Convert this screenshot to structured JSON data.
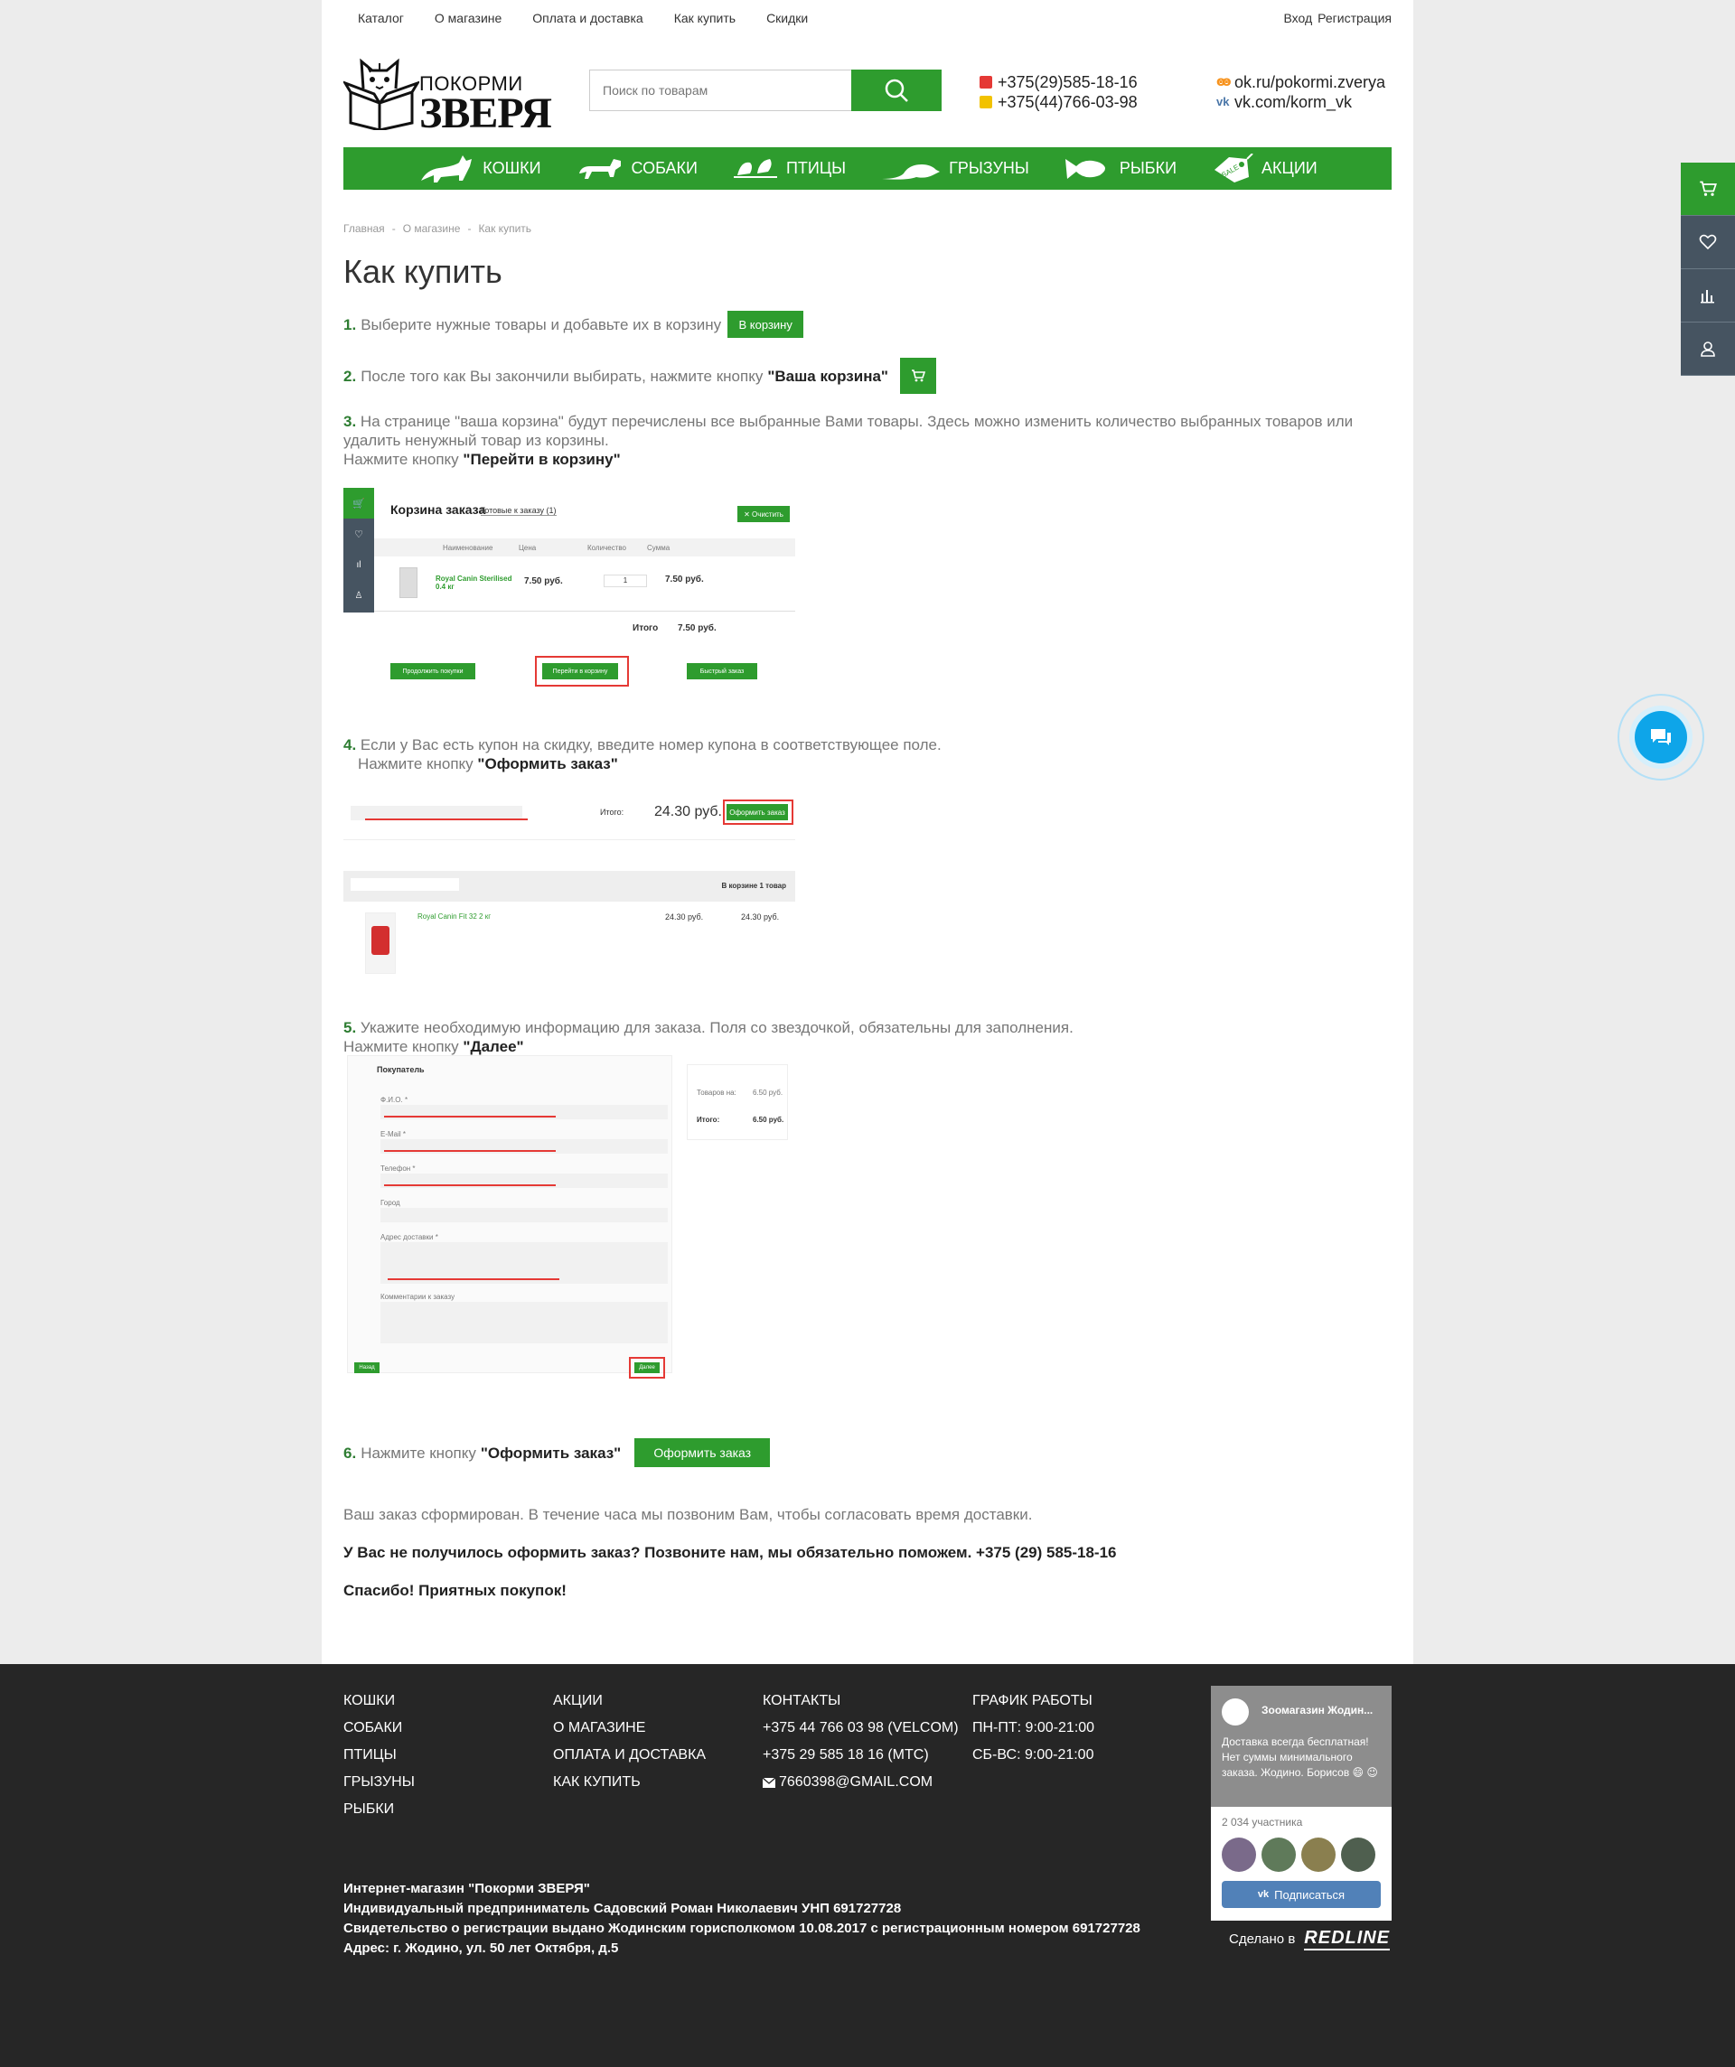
{
  "topbar": {
    "nav": [
      "Каталог",
      "О магазине",
      "Оплата и доставка",
      "Как купить",
      "Скидки"
    ],
    "login": "Вход",
    "register": "Регистрация"
  },
  "header": {
    "logo_small": "ПОКОРМИ",
    "logo_big": "ЗВЕРЯ",
    "search_placeholder": "Поиск по товарам",
    "phones": [
      "+375(29)585-18-16",
      "+375(44)766-03-98"
    ],
    "socials": [
      "ok.ru/pokormi.zverya",
      "vk.com/korm_vk"
    ]
  },
  "categories": [
    "КОШКИ",
    "СОБАКИ",
    "ПТИЦЫ",
    "ГРЫЗУНЫ",
    "РЫБКИ",
    "АКЦИИ"
  ],
  "breadcrumb": [
    "Главная",
    "О магазине",
    "Как купить"
  ],
  "page_title": "Как купить",
  "steps": {
    "s1": {
      "num": "1.",
      "text": "Выберите нужные товары и добавьте их в корзину",
      "button": "В корзину"
    },
    "s2": {
      "num": "2.",
      "text": "После того как Вы закончили выбирать, нажмите кнопку",
      "bold": "\"Ваша корзина\""
    },
    "s3": {
      "num": "3.",
      "text": "На странице \"ваша корзина\" будут перечислены все выбранные Вами товары. Здесь можно изменить количество выбранных товаров или удалить ненужный товар из корзины.",
      "line2": "Нажмите кнопку",
      "bold": "\"Перейти в корзину\""
    },
    "s4": {
      "num": "4.",
      "text": "Если у Вас есть купон на скидку, введите номер купона в соответствующее поле.",
      "line2": "Нажмите кнопку",
      "bold": "\"Оформить заказ\""
    },
    "s5": {
      "num": "5.",
      "text": "Укажите необходимую информацию для заказа. Поля со звездочкой, обязательны для заполнения.",
      "line2": "Нажмите кнопку",
      "bold": "\"Далее\""
    },
    "s6": {
      "num": "6.",
      "text": "Нажмите кнопку",
      "bold": "\"Оформить заказ\"",
      "button": "Оформить заказ"
    }
  },
  "cart_shot": {
    "title": "Корзина заказа",
    "tab": "Готовые к заказу (1)",
    "clear": "✕ Очистить",
    "cols": [
      "Наименование",
      "Цена",
      "Количество",
      "Сумма"
    ],
    "product": "Royal Canin Sterilised 0.4 кг",
    "price": "7.50 руб.",
    "qty": "1",
    "sum": "7.50 руб.",
    "total_label": "Итого",
    "total": "7.50 руб.",
    "btn_continue": "Продолжить покупки",
    "btn_goto": "Перейти в корзину",
    "btn_quick": "Быстрый заказ"
  },
  "order_shot": {
    "total_label": "Итого:",
    "total": "24.30 руб.",
    "btn": "Оформить заказ",
    "in_cart": "В корзине 1 товар",
    "product": "Royal Canin Fit 32 2 кг",
    "price": "24.30 руб.",
    "sum": "24.30 руб."
  },
  "form_shot": {
    "title": "Покупатель",
    "labels": [
      "Ф.И.О. *",
      "E-Mail *",
      "Телефон *",
      "Город",
      "Адрес доставки *",
      "Комментарии к заказу"
    ],
    "goods_label": "Товаров на:",
    "goods": "6.50 руб.",
    "total_label": "Итого:",
    "total": "6.50 руб.",
    "back": "Назад",
    "next": "Далее"
  },
  "after": {
    "formed": "Ваш заказ сформирован. В течение часа мы позвоним Вам, чтобы согласовать время доставки.",
    "help": "У Вас не получилось оформить заказ? Позвоните нам, мы обязательно поможем. +375 (29) 585-18-16",
    "thanks": "Спасибо! Приятных покупок!"
  },
  "footer": {
    "col1": [
      "КОШКИ",
      "СОБАКИ",
      "ПТИЦЫ",
      "ГРЫЗУНЫ",
      "РЫБКИ"
    ],
    "col2": [
      "АКЦИИ",
      "О МАГАЗИНЕ",
      "ОПЛАТА И ДОСТАВКА",
      "КАК КУПИТЬ"
    ],
    "col3": [
      "КОНТАКТЫ",
      "+375 44 766 03 98 (VELCOM)",
      "+375 29 585 18 16 (МТС)",
      "7660398@GMAIL.COM"
    ],
    "col4": [
      "ГРАФИК РАБОТЫ",
      "ПН-ПТ: 9:00-21:00",
      "СБ-ВС: 9:00-21:00"
    ],
    "legal": [
      "Интернет-магазин \"Покорми ЗВЕРЯ\"",
      "Индивидуальный предприниматель Садовский Роман Николаевич УНП 691727728",
      "Свидетельство о регистрации выдано Жодинским горисполкомом 10.08.2017 с регистрационным номером 691727728",
      "Адрес: г. Жодино, ул. 50 лет Октября, д.5"
    ],
    "vk_name": "Зоомагазин Жодин...",
    "vk_post": "Доставка всегда бесплатная! Нет суммы минимального заказа. Жодино. Борисов 😄 😉",
    "vk_members": "2 034 участника",
    "vk_subscribe": "Подписаться",
    "made_by": "Сделано в",
    "made_brand": "REDLINE"
  },
  "colors": {
    "green": "#2e9c2e",
    "footer": "#262626",
    "accent_blue": "#0ea5e9"
  }
}
